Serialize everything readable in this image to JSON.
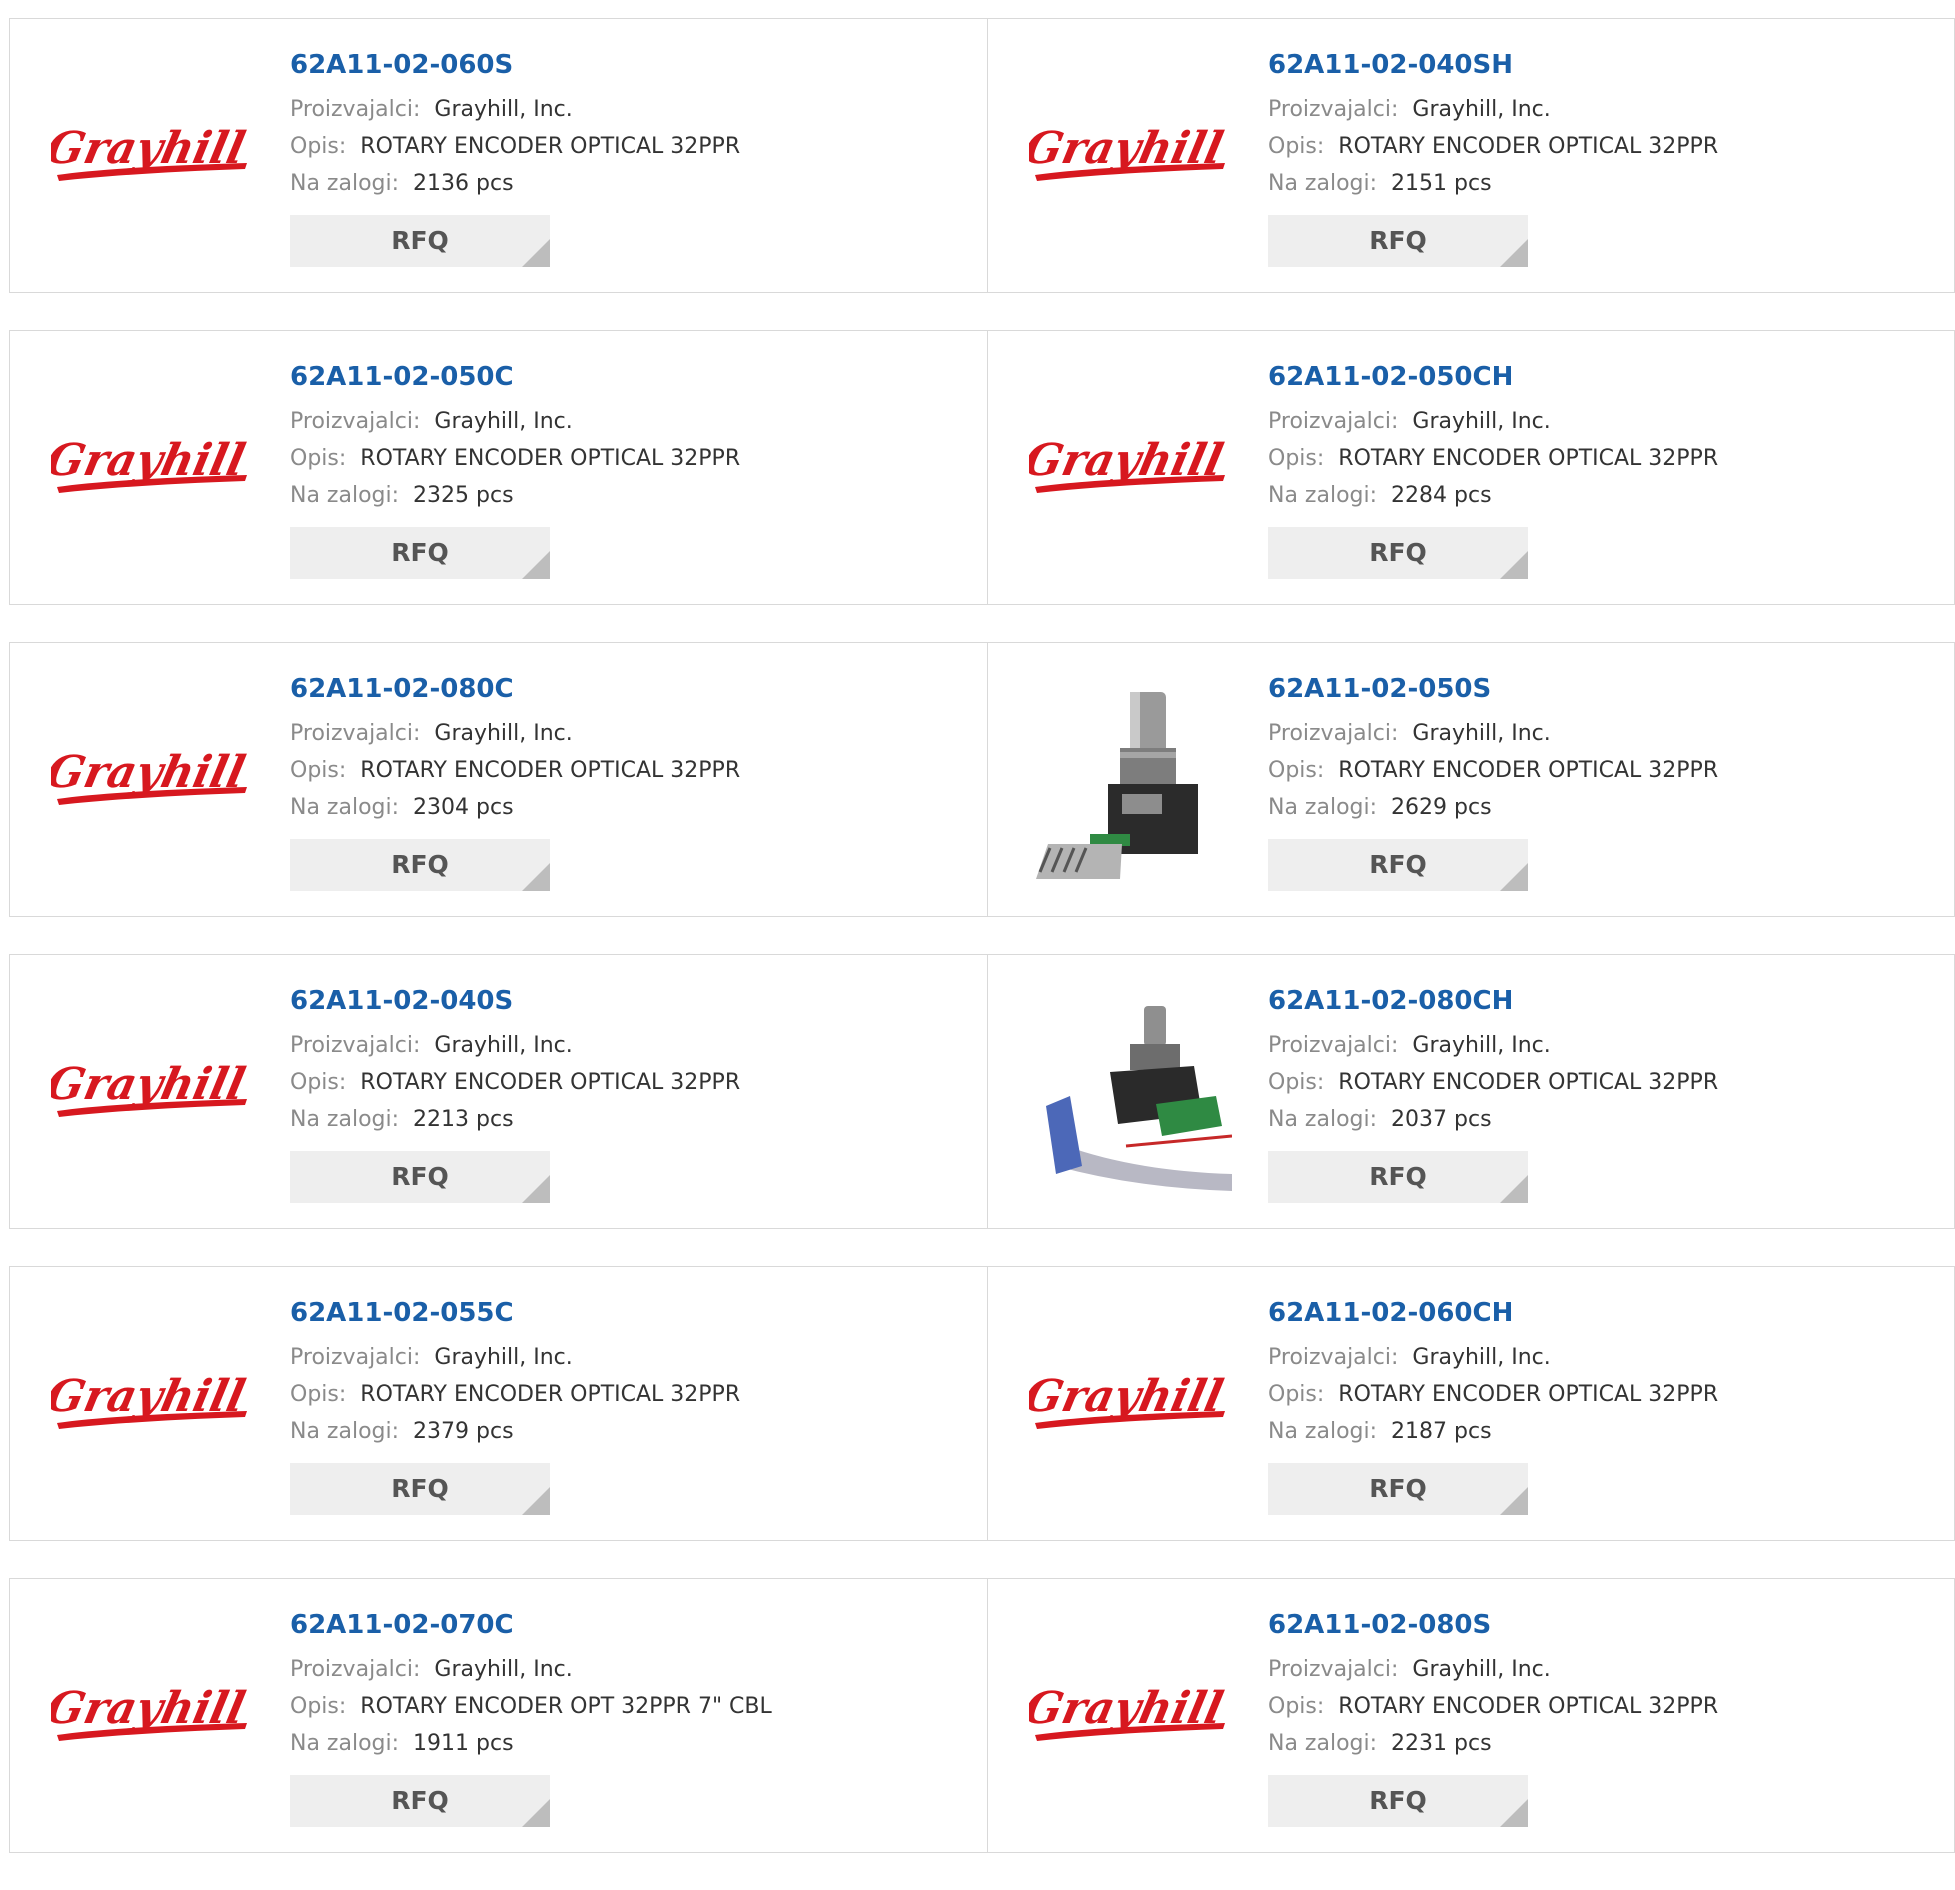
{
  "labels": {
    "manufacturer": "Proizvajalci:",
    "description": "Opis:",
    "stock": "Na zalogi:",
    "rfq": "RFQ"
  },
  "colors": {
    "part_link": "#1a5fa8",
    "brand_red": "#d7181f",
    "label_gray": "#8a8a8a",
    "button_bg": "#eeeeee"
  },
  "products": [
    {
      "part": "62A11-02-060S",
      "manufacturer": "Grayhill, Inc.",
      "description": "ROTARY ENCODER OPTICAL 32PPR",
      "stock": "2136 pcs",
      "image": "grayhill-logo"
    },
    {
      "part": "62A11-02-040SH",
      "manufacturer": "Grayhill, Inc.",
      "description": "ROTARY ENCODER OPTICAL 32PPR",
      "stock": "2151 pcs",
      "image": "grayhill-logo"
    },
    {
      "part": "62A11-02-050C",
      "manufacturer": "Grayhill, Inc.",
      "description": "ROTARY ENCODER OPTICAL 32PPR",
      "stock": "2325 pcs",
      "image": "grayhill-logo"
    },
    {
      "part": "62A11-02-050CH",
      "manufacturer": "Grayhill, Inc.",
      "description": "ROTARY ENCODER OPTICAL 32PPR",
      "stock": "2284 pcs",
      "image": "grayhill-logo"
    },
    {
      "part": "62A11-02-080C",
      "manufacturer": "Grayhill, Inc.",
      "description": "ROTARY ENCODER OPTICAL 32PPR",
      "stock": "2304 pcs",
      "image": "grayhill-logo"
    },
    {
      "part": "62A11-02-050S",
      "manufacturer": "Grayhill, Inc.",
      "description": "ROTARY ENCODER OPTICAL 32PPR",
      "stock": "2629 pcs",
      "image": "encoder-photo"
    },
    {
      "part": "62A11-02-040S",
      "manufacturer": "Grayhill, Inc.",
      "description": "ROTARY ENCODER OPTICAL 32PPR",
      "stock": "2213 pcs",
      "image": "grayhill-logo"
    },
    {
      "part": "62A11-02-080CH",
      "manufacturer": "Grayhill, Inc.",
      "description": "ROTARY ENCODER OPTICAL 32PPR",
      "stock": "2037 pcs",
      "image": "encoder-cable-photo"
    },
    {
      "part": "62A11-02-055C",
      "manufacturer": "Grayhill, Inc.",
      "description": "ROTARY ENCODER OPTICAL 32PPR",
      "stock": "2379 pcs",
      "image": "grayhill-logo"
    },
    {
      "part": "62A11-02-060CH",
      "manufacturer": "Grayhill, Inc.",
      "description": "ROTARY ENCODER OPTICAL 32PPR",
      "stock": "2187 pcs",
      "image": "grayhill-logo"
    },
    {
      "part": "62A11-02-070C",
      "manufacturer": "Grayhill, Inc.",
      "description": "ROTARY ENCODER OPT 32PPR 7\" CBL",
      "stock": "1911 pcs",
      "image": "grayhill-logo"
    },
    {
      "part": "62A11-02-080S",
      "manufacturer": "Grayhill, Inc.",
      "description": "ROTARY ENCODER OPTICAL 32PPR",
      "stock": "2231 pcs",
      "image": "grayhill-logo"
    }
  ]
}
